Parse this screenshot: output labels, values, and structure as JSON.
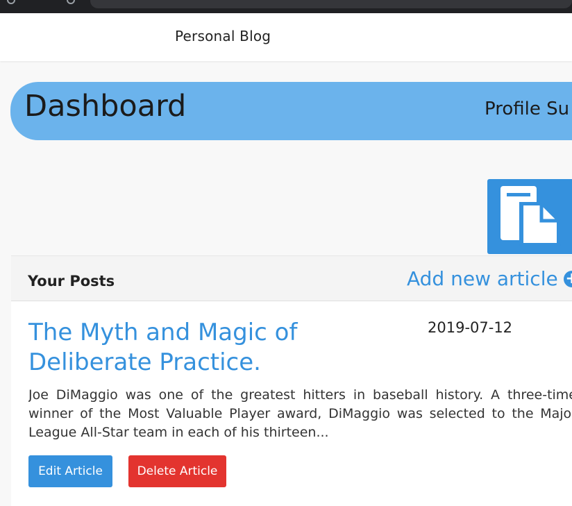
{
  "navbar": {
    "brand": "Personal Blog"
  },
  "dashboard": {
    "title": "Dashboard",
    "profile_link": "Profile Su"
  },
  "posts_section": {
    "header": "Your Posts",
    "add_link": "Add new article",
    "posts": [
      {
        "title": "The Myth and Magic of Deliberate Practice.",
        "date": "2019-07-12",
        "excerpt": "Joe DiMaggio was one of the greatest hitters in baseball history. A three-time winner of the Most Valuable Player award, DiMaggio was selected to the Major League All-Star team in each of his thirteen...",
        "edit_label": "Edit Article",
        "delete_label": "Delete Article"
      }
    ]
  },
  "colors": {
    "accent": "#3591dd",
    "banner": "#6bb3ec",
    "danger": "#e3342f"
  },
  "icons": [
    "document-copy-icon",
    "plus-circle-icon"
  ]
}
